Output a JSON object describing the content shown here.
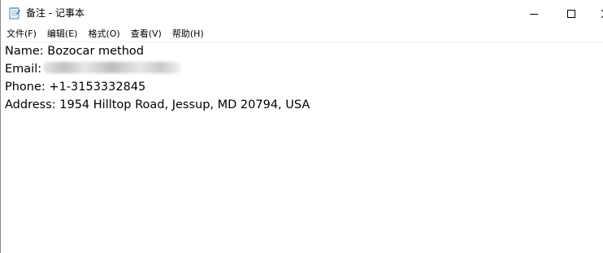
{
  "window": {
    "title": "备注 - 记事本",
    "icon": "notepad-icon"
  },
  "window_controls": {
    "minimize_icon": "minimize-icon",
    "maximize_icon": "maximize-icon",
    "close_icon": "close-icon"
  },
  "menu": [
    {
      "label": "文件(F)"
    },
    {
      "label": "编辑(E)"
    },
    {
      "label": "格式(O)"
    },
    {
      "label": "查看(V)"
    },
    {
      "label": "帮助(H)"
    }
  ],
  "document": {
    "lines": [
      {
        "label": "Name:",
        "value": " Bozocar method"
      },
      {
        "label": "Email:",
        "value": ""
      },
      {
        "label": "Phone:",
        "value": " +1-3153332845"
      },
      {
        "label": "Address:",
        "value": " 1954 Hilltop Road, Jessup, MD 20794, USA"
      }
    ]
  }
}
